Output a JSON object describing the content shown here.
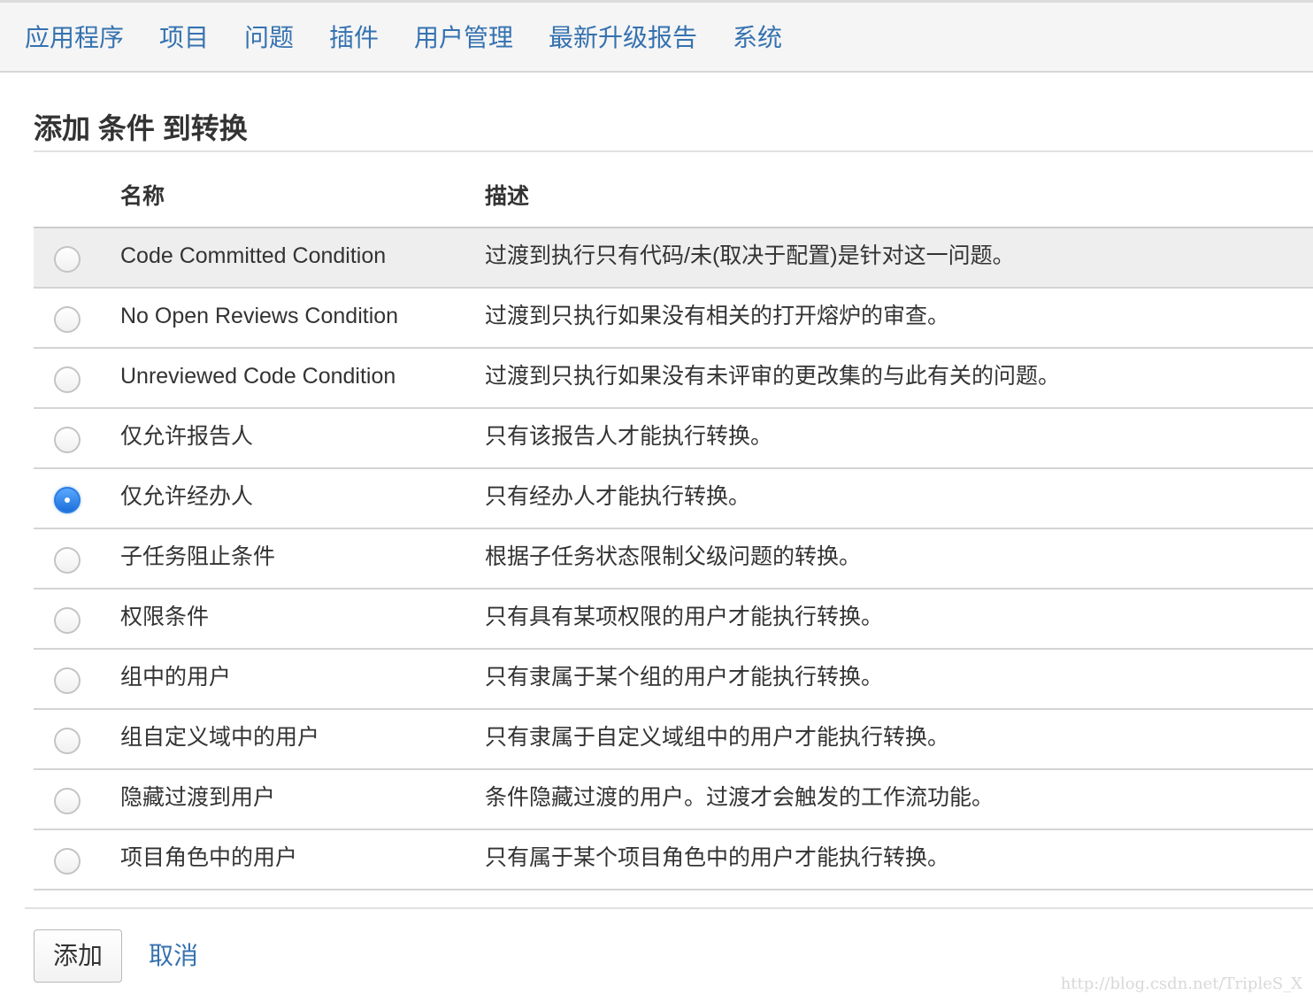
{
  "nav": {
    "items": [
      {
        "label": "应用程序"
      },
      {
        "label": "项目"
      },
      {
        "label": "问题"
      },
      {
        "label": "插件"
      },
      {
        "label": "用户管理"
      },
      {
        "label": "最新升级报告"
      },
      {
        "label": "系统"
      }
    ]
  },
  "page": {
    "title": "添加 条件 到转换"
  },
  "table": {
    "headers": {
      "name": "名称",
      "description": "描述"
    },
    "rows": [
      {
        "name": "Code Committed Condition",
        "description": "过渡到执行只有代码/未(取决于配置)是针对这一问题。",
        "selected": false
      },
      {
        "name": "No Open Reviews Condition",
        "description": "过渡到只执行如果没有相关的打开熔炉的审查。",
        "selected": false
      },
      {
        "name": "Unreviewed Code Condition",
        "description": "过渡到只执行如果没有未评审的更改集的与此有关的问题。",
        "selected": false
      },
      {
        "name": "仅允许报告人",
        "description": "只有该报告人才能执行转换。",
        "selected": false
      },
      {
        "name": "仅允许经办人",
        "description": "只有经办人才能执行转换。",
        "selected": true
      },
      {
        "name": "子任务阻止条件",
        "description": "根据子任务状态限制父级问题的转换。",
        "selected": false
      },
      {
        "name": "权限条件",
        "description": "只有具有某项权限的用户才能执行转换。",
        "selected": false
      },
      {
        "name": "组中的用户",
        "description": "只有隶属于某个组的用户才能执行转换。",
        "selected": false
      },
      {
        "name": "组自定义域中的用户",
        "description": "只有隶属于自定义域组中的用户才能执行转换。",
        "selected": false
      },
      {
        "name": "隐藏过渡到用户",
        "description": "条件隐藏过渡的用户。过渡才会触发的工作流功能。",
        "selected": false
      },
      {
        "name": "项目角色中的用户",
        "description": "只有属于某个项目角色中的用户才能执行转换。",
        "selected": false
      }
    ]
  },
  "actions": {
    "add_label": "添加",
    "cancel_label": "取消"
  },
  "watermark": "http://blog.csdn.net/TripleS_X",
  "colors": {
    "link": "#3572b0",
    "radio_selected": "#2a7de1",
    "row_hover": "#eeeeee"
  }
}
